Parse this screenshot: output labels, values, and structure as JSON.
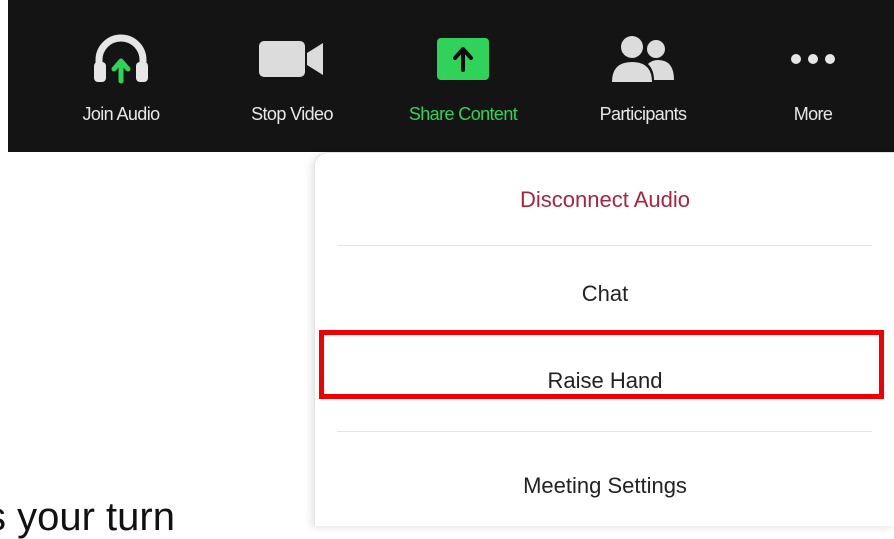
{
  "toolbar": {
    "items": [
      {
        "label": "Join Audio",
        "icon": "headphones-icon"
      },
      {
        "label": "Stop Video",
        "icon": "video-camera-icon"
      },
      {
        "label": "Share Content",
        "icon": "share-up-arrow-icon"
      },
      {
        "label": "Participants",
        "icon": "participants-icon"
      },
      {
        "label": "More",
        "icon": "more-dots-icon"
      }
    ],
    "accent_color": "#2fd35a"
  },
  "more_menu": {
    "items": [
      {
        "label": "Disconnect Audio"
      },
      {
        "label": "Chat"
      },
      {
        "label": "Raise Hand"
      },
      {
        "label": "Meeting Settings"
      }
    ],
    "danger_color": "#a8253f",
    "highlight_color": "#f00000"
  },
  "background_text": "s your turn"
}
